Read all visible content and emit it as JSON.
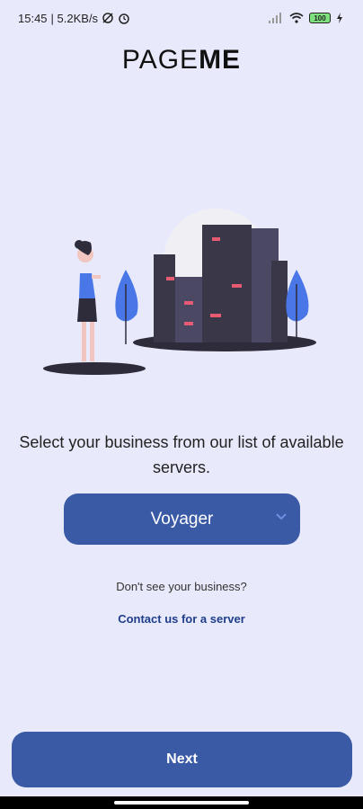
{
  "status": {
    "time": "15:45",
    "speed": "| 5.2KB/s",
    "battery": "100"
  },
  "logo": {
    "light": "PAGE",
    "bold": "ME"
  },
  "illustration": {
    "name": "person-city-illustration",
    "accent": "#4a77e8",
    "building": "#3a3848"
  },
  "prompt": "Select your business from our list of available servers.",
  "server_select": {
    "value": "Voyager",
    "icon": "chevron-down-icon"
  },
  "question": "Don't see your business?",
  "contact_link": "Contact us for a server",
  "next_button": "Next",
  "colors": {
    "background": "#e8eafc",
    "primary": "#3a5aa6",
    "link": "#1f3e8a"
  }
}
